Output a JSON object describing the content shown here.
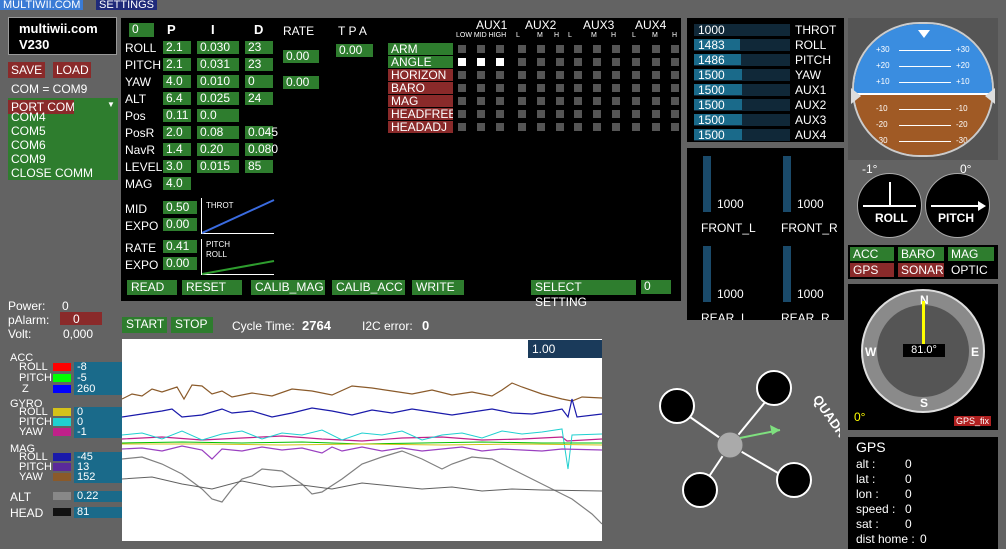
{
  "tabs": {
    "t1": "MULTIWII.COM",
    "t2": "SETTINGS"
  },
  "brand": {
    "line1": "multiwii.com",
    "line2": "V230"
  },
  "buttons": {
    "save": "SAVE",
    "load": "LOAD",
    "read": "READ",
    "reset": "RESET",
    "calib_mag": "CALIB_MAG",
    "calib_acc": "CALIB_ACC",
    "write": "WRITE",
    "select_setting": "SELECT SETTING",
    "start": "START",
    "stop": "STOP"
  },
  "com": {
    "status": "COM = COM9",
    "port": "PORT COM",
    "list": [
      "COM4",
      "COM5",
      "COM6",
      "COM9",
      "CLOSE COMM"
    ]
  },
  "pid": {
    "zero": "0",
    "headers": {
      "p": "P",
      "i": "I",
      "d": "D",
      "rate": "RATE",
      "tpa": "T P A"
    },
    "rows": [
      {
        "name": "ROLL",
        "p": "2.1",
        "i": "0.030",
        "d": "23"
      },
      {
        "name": "PITCH",
        "p": "2.1",
        "i": "0.031",
        "d": "23"
      },
      {
        "name": "YAW",
        "p": "4.0",
        "i": "0.010",
        "d": "0"
      },
      {
        "name": "ALT",
        "p": "6.4",
        "i": "0.025",
        "d": "24"
      },
      {
        "name": "Pos",
        "p": "0.11",
        "i": "0.0",
        "d": ""
      },
      {
        "name": "PosR",
        "p": "2.0",
        "i": "0.08",
        "d": "0.045"
      },
      {
        "name": "NavR",
        "p": "1.4",
        "i": "0.20",
        "d": "0.080"
      },
      {
        "name": "LEVEL",
        "p": "3.0",
        "i": "0.015",
        "d": "85"
      },
      {
        "name": "MAG",
        "p": "4.0",
        "i": "",
        "d": ""
      }
    ],
    "rate_rp": "0.00",
    "rate_yaw": "0.00",
    "tpa": "0.00",
    "mid_label": "MID",
    "mid": "0.50",
    "expo_label": "EXPO",
    "expo": "0.00",
    "throt_label": "THROT",
    "rate_label": "RATE",
    "rate": "0.41",
    "expo2": "0.00",
    "pitch_label": "PITCH",
    "roll_label": "ROLL",
    "setting": "0"
  },
  "aux": {
    "headers": [
      "AUX1",
      "AUX2",
      "AUX3",
      "AUX4"
    ],
    "sub1": "LOW MID HIGH",
    "sub": [
      "L",
      "M",
      "H"
    ],
    "modes": [
      {
        "name": "ARM",
        "c": "g"
      },
      {
        "name": "ANGLE",
        "c": "g"
      },
      {
        "name": "HORIZON",
        "c": "r"
      },
      {
        "name": "BARO",
        "c": "r"
      },
      {
        "name": "MAG",
        "c": "r"
      },
      {
        "name": "HEADFREE",
        "c": "r"
      },
      {
        "name": "HEADADJ",
        "c": "r"
      }
    ]
  },
  "rc": [
    {
      "v": "1000",
      "n": "THROT",
      "f": 0.0
    },
    {
      "v": "1483",
      "n": "ROLL",
      "f": 0.48
    },
    {
      "v": "1486",
      "n": "PITCH",
      "f": 0.49
    },
    {
      "v": "1500",
      "n": "YAW",
      "f": 0.5
    },
    {
      "v": "1500",
      "n": "AUX1",
      "f": 0.5
    },
    {
      "v": "1500",
      "n": "AUX2",
      "f": 0.5
    },
    {
      "v": "1500",
      "n": "AUX3",
      "f": 0.5
    },
    {
      "v": "1500",
      "n": "AUX4",
      "f": 0.5
    }
  ],
  "motors": [
    {
      "v": "1000",
      "n": "FRONT_L"
    },
    {
      "v": "1000",
      "n": "FRONT_R"
    },
    {
      "v": "1000",
      "n": "REAR_L"
    },
    {
      "v": "1000",
      "n": "REAR_R"
    }
  ],
  "horizon": {
    "marks": [
      "+30",
      "+20",
      "+10",
      "-10",
      "-20",
      "-30"
    ],
    "roll_angle": "-1°",
    "pitch_angle": "0°",
    "roll_label": "ROLL",
    "pitch_label": "PITCH"
  },
  "sensors": {
    "acc": "ACC",
    "baro": "BARO",
    "mag": "MAG",
    "gps": "GPS",
    "sonar": "SONAR",
    "optic": "OPTIC"
  },
  "compass": {
    "heading": "81.0°",
    "n": "N",
    "s": "S",
    "e": "E",
    "w": "W",
    "alt": "0°",
    "gps_fix": "GPS_fix"
  },
  "gps": {
    "title": "GPS",
    "alt_l": "alt  :",
    "alt": "0",
    "lat_l": "lat  :",
    "lat": "0",
    "lon_l": "lon  :",
    "lon": "0",
    "speed_l": "speed :",
    "speed": "0",
    "sat_l": "sat  :",
    "sat": "0",
    "dist_l": "dist home :",
    "dist": "0"
  },
  "power": {
    "power_l": "Power:",
    "power": "0",
    "palarm_l": "pAlarm:",
    "palarm": "0",
    "volt_l": "Volt:",
    "volt": "0,000"
  },
  "cycle": {
    "label": "Cycle Time:",
    "value": "2764",
    "i2c_label": "I2C error:",
    "i2c": "0"
  },
  "graph": {
    "scale": "1.00"
  },
  "sensor_vals": {
    "acc": "ACC",
    "roll": "ROLL",
    "pitch": "PITCH",
    "z": "Z",
    "acc_roll": "-8",
    "acc_pitch": "-5",
    "acc_z": "260",
    "gyro": "GYRO",
    "gyro_roll": "0",
    "gyro_pitch": "0",
    "gyro_yaw": "-1",
    "yaw": "YAW",
    "mag": "MAG",
    "mag_roll": "-45",
    "mag_pitch": "13",
    "mag_yaw": "152",
    "alt": "ALT",
    "alt_v": "0.22",
    "head": "HEAD",
    "head_v": "81"
  },
  "quad_label": "QUADRICOPTER X",
  "colors": {
    "green": "#2e7d2e",
    "red": "#8a2a2a",
    "sky": "#3a8de0",
    "ground": "#a05a25"
  }
}
